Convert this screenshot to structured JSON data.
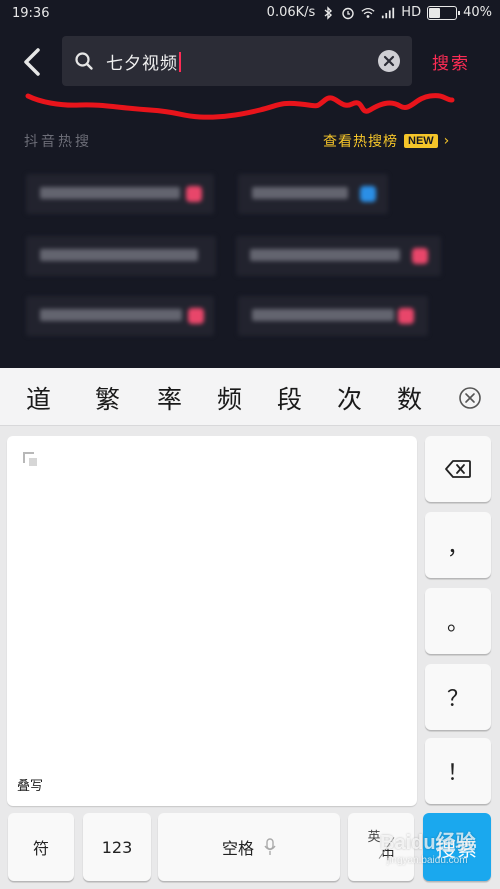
{
  "status_bar": {
    "time": "19:36",
    "network_speed": "0.06K/s",
    "network_type": "HD",
    "battery": "40%",
    "battery_level": 0.4,
    "icons": [
      "bluetooth-icon",
      "alarm-icon",
      "wifi-icon",
      "signal-icon",
      "battery-icon"
    ]
  },
  "search_header": {
    "back_icon": "chevron-left-icon",
    "search_icon": "search-icon",
    "query": "七夕视频",
    "clear_icon": "clear-icon",
    "search_label": "搜索"
  },
  "hot_search": {
    "section_label": "抖音热搜",
    "board_link": "查看热搜榜",
    "new_badge": "NEW",
    "items_blurred": true,
    "item_count": 6
  },
  "keyboard": {
    "candidates": [
      "道",
      "繁",
      "率",
      "频",
      "段",
      "次",
      "数"
    ],
    "close_icon": "close-circle-icon",
    "handwriting_mode_label": "叠写",
    "side_keys": [
      {
        "label": "",
        "icon": "backspace-icon"
      },
      {
        "label": "，"
      },
      {
        "label": "。"
      },
      {
        "label": "？"
      },
      {
        "label": "！"
      }
    ],
    "bottom_keys": {
      "symbol": "符",
      "numeric": "123",
      "space": "空格",
      "lang_top": "英",
      "lang_bottom": "中",
      "go": "搜索"
    }
  },
  "watermark": {
    "text": "Baidu经验",
    "subtext": "jingyan.baidu.com"
  },
  "colors": {
    "app_bg": "#161823",
    "accent_red": "#fe2c55",
    "hot_yellow": "#f5c52a",
    "keyboard_bg": "#e9e9ea",
    "go_key_blue": "#1aa8ee"
  }
}
